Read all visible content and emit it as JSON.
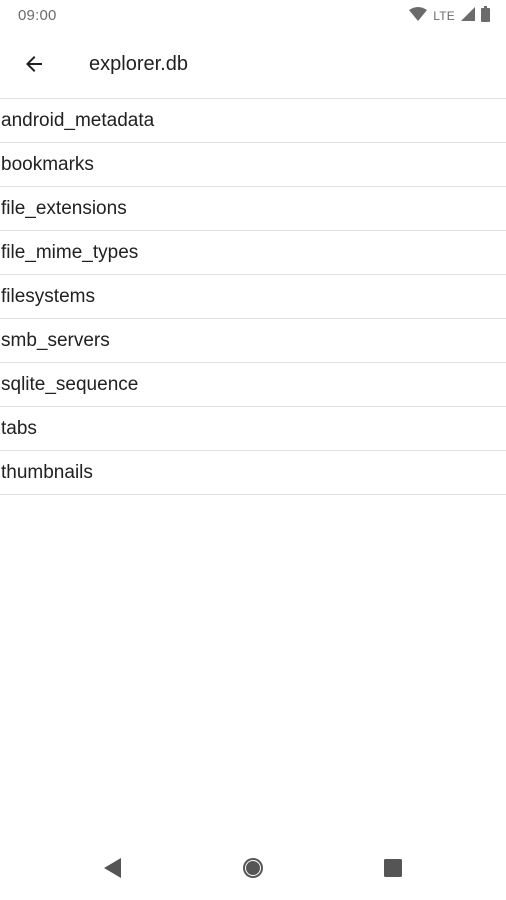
{
  "status_bar": {
    "time": "09:00",
    "network": "LTE",
    "icons": [
      "wifi-icon",
      "cell-signal-icon",
      "battery-icon"
    ]
  },
  "app_bar": {
    "back_icon": "arrow-back-icon",
    "title": "explorer.db"
  },
  "tables": [
    "android_metadata",
    "bookmarks",
    "file_extensions",
    "file_mime_types",
    "filesystems",
    "smb_servers",
    "sqlite_sequence",
    "tabs",
    "thumbnails"
  ],
  "nav_bar": {
    "icons": [
      "nav-back-icon",
      "nav-home-icon",
      "nav-recents-icon"
    ]
  },
  "colors": {
    "icon_gray": "#6b6b6b",
    "text": "#212121",
    "divider": "#e0e0e0",
    "nav_icon": "#555555"
  }
}
